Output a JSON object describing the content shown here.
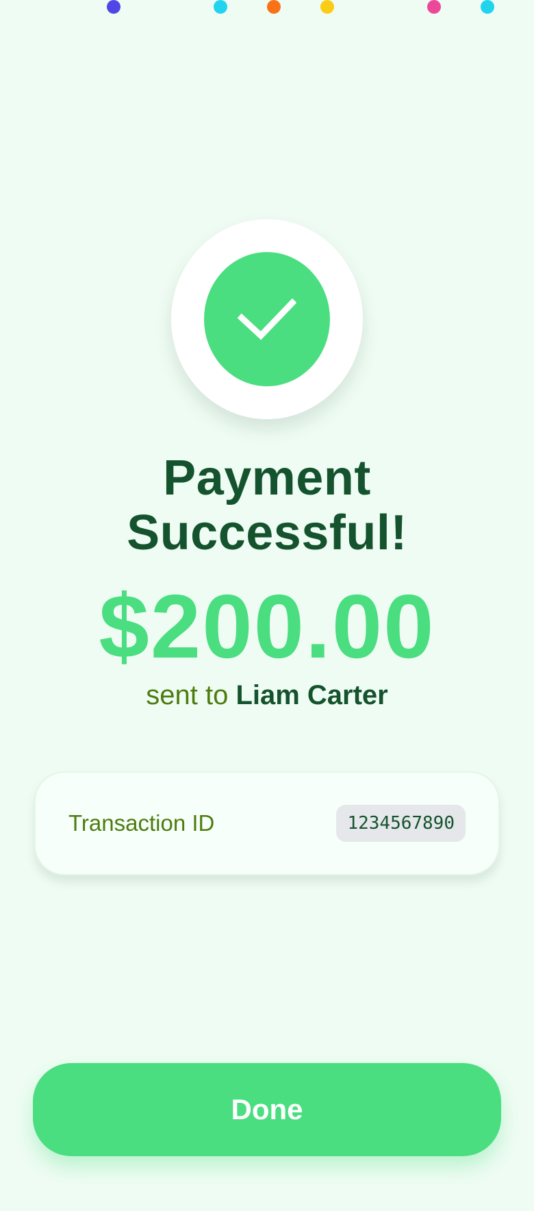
{
  "colors": {
    "background": "#effcf3",
    "accent": "#4ade80",
    "title": "#14532d",
    "muted": "#4d7c0f",
    "confetti": [
      "#4f46e5",
      "#22d3ee",
      "#f97316",
      "#facc15",
      "#ec4899",
      "#22d3ee"
    ]
  },
  "status": {
    "icon": "check-icon",
    "title_line1": "Payment",
    "title_line2": "Successful!"
  },
  "payment": {
    "amount": "$200.00",
    "sent_prefix": "sent to",
    "recipient": "Liam Carter"
  },
  "transaction": {
    "label": "Transaction ID",
    "value": "1234567890"
  },
  "actions": {
    "done_label": "Done"
  }
}
